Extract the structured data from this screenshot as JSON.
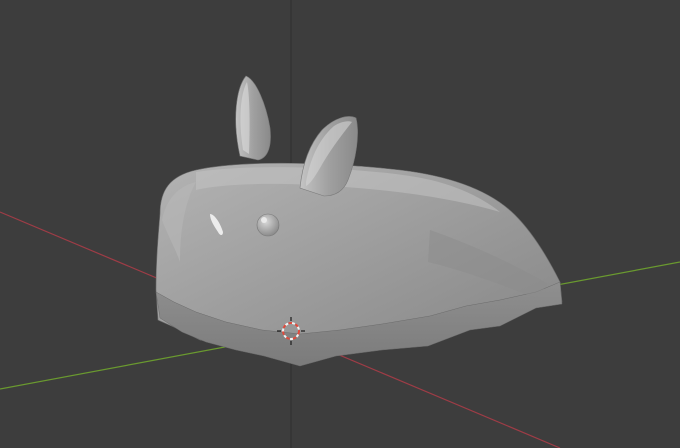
{
  "viewport": {
    "mode": "3d-viewport",
    "shading": "solid",
    "background_color": "#3d3d3d",
    "grid_line_color": "#353535",
    "axis_x_color": "#9e3c46",
    "axis_y_color": "#6a9a2f",
    "axis_z_color": "#2e2e2e"
  },
  "object": {
    "kind": "low-poly-bunny-mesh",
    "base_color": "#9a9a9a",
    "highlight_color": "#d2d2d2",
    "shadow_color": "#6f6f6f"
  },
  "cursor": {
    "kind": "3d-cursor",
    "ring_color_a": "#e14a3c",
    "ring_color_b": "#f2f2f2"
  }
}
